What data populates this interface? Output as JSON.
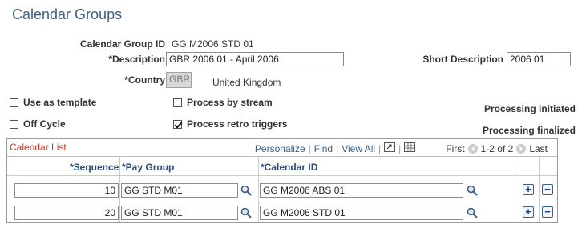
{
  "page": {
    "title": "Calendar Groups"
  },
  "form": {
    "calendar_group_id_label": "Calendar Group ID",
    "calendar_group_id_value": "GG M2006 STD 01",
    "description_label": "*Description",
    "description_value": "GBR 2006 01 - April 2006",
    "short_description_label": "Short Description",
    "short_description_value": "2006 01",
    "country_label": "*Country",
    "country_value": "GBR",
    "country_name": "United Kingdom",
    "use_as_template": {
      "label": "Use as template",
      "checked": false
    },
    "process_by_stream": {
      "label": "Process by stream",
      "checked": false
    },
    "off_cycle": {
      "label": "Off Cycle",
      "checked": false
    },
    "process_retro_triggers": {
      "label": "Process retro triggers",
      "checked": true
    },
    "processing_initiated": "Processing initiated",
    "processing_finalized": "Processing finalized"
  },
  "calendar_list": {
    "title": "Calendar List",
    "personalize": "Personalize",
    "find": "Find",
    "view_all": "View All",
    "first": "First",
    "range": "1-2 of 2",
    "last": "Last",
    "columns": {
      "sequence": "*Sequence",
      "pay_group": "*Pay Group",
      "calendar_id": "*Calendar ID"
    },
    "rows": [
      {
        "sequence": "10",
        "pay_group": "GG STD M01",
        "calendar_id": "GG M2006 ABS 01"
      },
      {
        "sequence": "20",
        "pay_group": "GG STD M01",
        "calendar_id": "GG M2006 STD 01"
      }
    ],
    "add_symbol": "+",
    "delete_symbol": "−"
  },
  "icons": {
    "lookup": "magnifier-icon",
    "zoom": "grid-zoom-icon",
    "download": "download-grid-icon",
    "prev": "prev-arrow-icon",
    "next": "next-arrow-icon"
  }
}
